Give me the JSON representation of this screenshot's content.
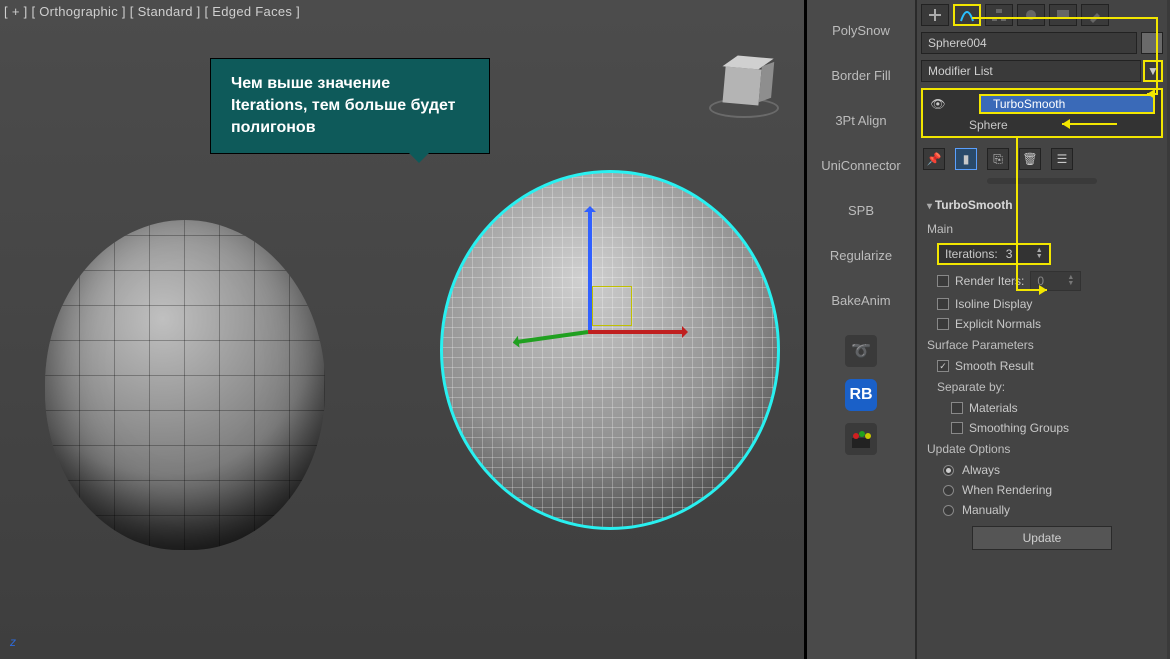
{
  "viewport": {
    "header": "[ + ] [ Orthographic ] [ Standard ] [ Edged Faces ]",
    "axis_label": "z",
    "tooltip": "Чем выше значение Iterations, тем больше будет полигонов"
  },
  "tool_column": {
    "items": [
      "PolySnow",
      "Border Fill",
      "3Pt Align",
      "UniConnector",
      "SPB",
      "Regularize",
      "BakeAnim"
    ],
    "icon_items": [
      "swirl-icon",
      "rb-icon",
      "palette-icon"
    ]
  },
  "panel": {
    "tabs": [
      {
        "name": "create-tab",
        "active": false
      },
      {
        "name": "modify-tab",
        "active": true
      },
      {
        "name": "hierarchy-tab",
        "active": false
      },
      {
        "name": "motion-tab",
        "active": false
      },
      {
        "name": "display-tab",
        "active": false
      },
      {
        "name": "utilities-tab",
        "active": false
      }
    ],
    "object_name": "Sphere004",
    "modifier_list_label": "Modifier List",
    "stack": [
      {
        "label": "TurboSmooth",
        "selected": true
      },
      {
        "label": "Sphere",
        "selected": false
      }
    ],
    "rollout": {
      "title": "TurboSmooth",
      "main_label": "Main",
      "iterations": {
        "label": "Iterations:",
        "value": "3"
      },
      "render_iters": {
        "label": "Render Iters:",
        "value": "0"
      },
      "isoline": "Isoline Display",
      "explicit": "Explicit Normals",
      "surface_params": "Surface Parameters",
      "smooth_result": "Smooth Result",
      "separate_by": "Separate by:",
      "materials": "Materials",
      "smoothing_groups": "Smoothing Groups",
      "update_options": "Update Options",
      "always": "Always",
      "when_rendering": "When Rendering",
      "manually": "Manually",
      "update_btn": "Update"
    }
  }
}
